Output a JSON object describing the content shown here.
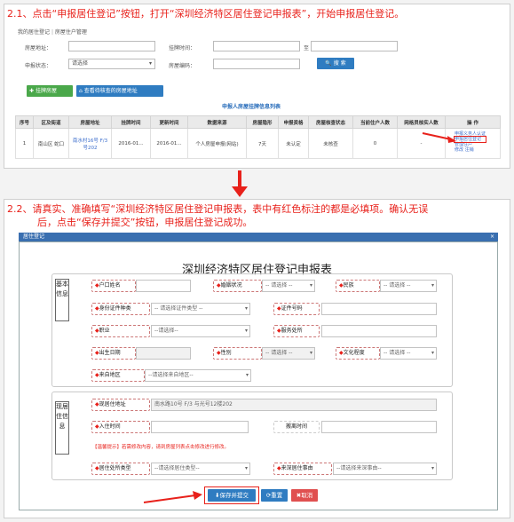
{
  "step1": {
    "text": "2.1、点击“申报居住登记”按钮，打开“深圳经济特区居住登记申报表”，开始申报居住登记。"
  },
  "step2": {
    "line1": "2.2、请真实、准确填写“深圳经济特区居住登记申报表，表中有红色标注的都是必填项。确认无误",
    "line2": "后，点击“保存并提交”按钮，申报居住登记成功。"
  },
  "breadcrumb": {
    "item1": "我的居住登记",
    "item2": "房屋住户管理"
  },
  "filters": {
    "address_label": "房屋地址：",
    "time_label": "挂牌时间：",
    "to_label": "至",
    "status_label": "申报状态：",
    "status_value": "请选择",
    "code_label": "房屋编码：",
    "search_button": "搜 索"
  },
  "actions": {
    "add_button": "挂牌房屋",
    "view_button": "查看待核查的房屋地址"
  },
  "table": {
    "title": "申报人房屋挂牌信息列表",
    "headers": [
      "序号",
      "区及街道",
      "房屋地址",
      "挂牌时间",
      "更新时间",
      "数据来源",
      "房屋隐形",
      "申报资格",
      "房屋核查状态",
      "当前住户人数",
      "网格员核实人数",
      "操 作"
    ],
    "row": {
      "index": "1",
      "district": "南山区 蛇口",
      "address_line1": "南水村16号 F/3",
      "address_line2": "号202",
      "listed": "2016-01...",
      "updated": "2016-01...",
      "source": "个人房屋申报(网站)",
      "hidden": "7天",
      "qualification": "未认定",
      "check_status": "未核查",
      "residents": "0",
      "verified": "-"
    },
    "ops": [
      "申报义务人认证",
      "申报居住登记",
      "管理住户",
      "修改 注销"
    ]
  },
  "window": {
    "title": "居住登记"
  },
  "form": {
    "title": "深圳经济特区居住登记申报表",
    "section1": "基本信息",
    "section2": "现居住信息",
    "name": "户口姓名",
    "marital": "婚姻状况",
    "ethnic": "民族",
    "id_type": "身份证件种类",
    "id_number": "证件号码",
    "occupation": "职业",
    "service": "服务处所",
    "birth": "出生日期",
    "gender": "性别",
    "education": "文化程度",
    "origin": "来自地区",
    "address": "现居住地址",
    "checkin": "入住时间",
    "checkout": "搬离时间",
    "residence_type": "居住处所类型",
    "reason": "来深居住事由",
    "sel_please": "-- 请选择 --",
    "sel_please2": "--请选择--",
    "sel_id_type": "-- 请选择证件类型 --",
    "sel_origin": "--请选择来自地区--",
    "sel_residence": "--请选择居住类型--",
    "sel_reason": "--请选择来深事由--",
    "address_value": "南水路10号 F/3 与光号12楼202",
    "tip": "【温馨提示】若需修改内容，请到房屋列表点击修改进行修改。",
    "save_submit": "保存并提交",
    "reset": "重置",
    "cancel": "取消"
  },
  "colors": {
    "accent": "#3a6fb0",
    "required": "#e8211b",
    "green": "#4aa84a",
    "primary": "#2f7cc1",
    "cancel": "#e05050"
  }
}
